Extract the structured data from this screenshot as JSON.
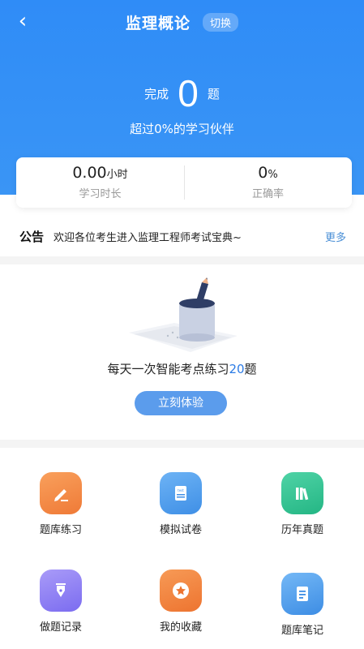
{
  "header": {
    "title": "监理概论",
    "switch_label": "切换",
    "done_prefix": "完成",
    "done_count": "0",
    "done_suffix": "题",
    "beat_text": "超过0%的学习伙伴",
    "accent_color": "#3a95f5"
  },
  "stats": {
    "study_time_value": "0.00",
    "study_time_unit": "小时",
    "study_time_label": "学习时长",
    "accuracy_value": "0",
    "accuracy_unit": "%",
    "accuracy_label": "正确率"
  },
  "notice": {
    "tag": "公告",
    "message": "欢迎各位考生进入监理工程师考试宝典~",
    "more": "更多"
  },
  "daily_practice": {
    "desc_prefix": "每天一次智能考点练习",
    "desc_count": "20",
    "desc_suffix": "题",
    "button": "立刻体验"
  },
  "features": [
    {
      "label": "题库练习",
      "icon": "pencil-icon"
    },
    {
      "label": "模拟试卷",
      "icon": "test-paper-icon"
    },
    {
      "label": "历年真题",
      "icon": "books-icon"
    },
    {
      "label": "做题记录",
      "icon": "fountain-pen-icon"
    },
    {
      "label": "我的收藏",
      "icon": "star-icon"
    },
    {
      "label": "题库笔记",
      "icon": "note-icon"
    }
  ]
}
